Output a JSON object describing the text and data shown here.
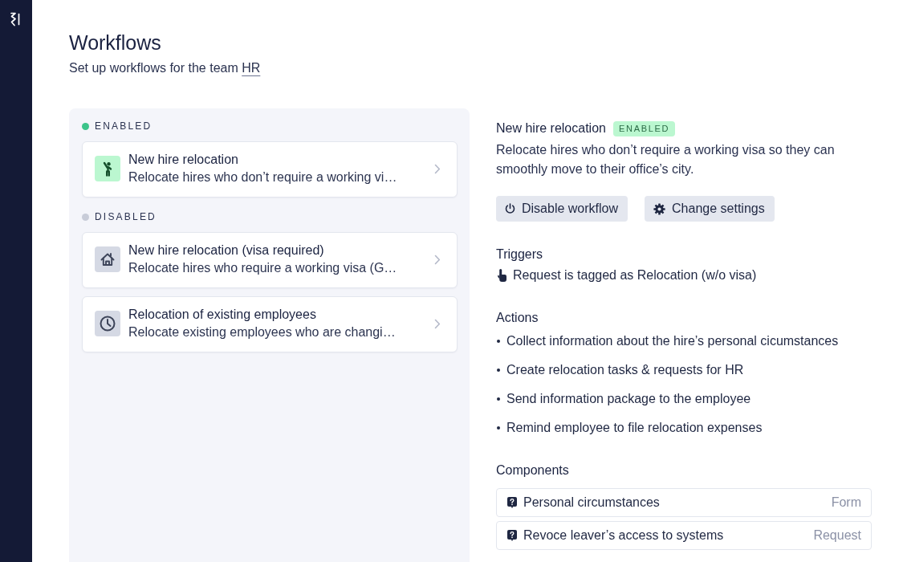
{
  "header": {
    "title": "Workflows",
    "subtitle": "Set up workflows for the team",
    "team_link": "HR"
  },
  "workflow_groups": [
    {
      "label": "ENABLED",
      "enabled": true,
      "color": "#3cc48a",
      "workflows": [
        {
          "kind": "person",
          "title": "New hire relocation",
          "description": "Relocate hires who don’t require a working vi…"
        }
      ]
    },
    {
      "label": "DISABLED",
      "enabled": false,
      "color": "#c8ccd8",
      "workflows": [
        {
          "kind": "house",
          "title": "New hire relocation (visa required)",
          "description": "Relocate hires who require a working visa (G…"
        },
        {
          "kind": "clock",
          "title": "Relocation of existing employees",
          "description": "Relocate existing employees who are changi…"
        }
      ]
    }
  ],
  "detail": {
    "title": "New hire relocation",
    "badge": "ENABLED",
    "description": "Relocate hires who don’t require a working visa so they can smoothly move to their office’s city.",
    "buttons": [
      {
        "kind": "power",
        "label": "Disable workflow"
      },
      {
        "kind": "gear",
        "label": "Change settings"
      }
    ],
    "triggers": {
      "heading": "Triggers",
      "items": [
        "Request is tagged as Relocation (w/o visa)"
      ]
    },
    "actions": {
      "heading": "Actions",
      "items": [
        "Collect information about the hire’s personal cicumstances",
        "Create relocation tasks & requests for HR",
        "Send information package to the employee",
        "Remind employee to file relocation expenses"
      ]
    },
    "components": {
      "heading": "Components",
      "items": [
        {
          "name": "Personal circumstances",
          "type": "Form"
        },
        {
          "name": "Revoce leaver’s access to systems",
          "type": "Request"
        }
      ]
    }
  }
}
